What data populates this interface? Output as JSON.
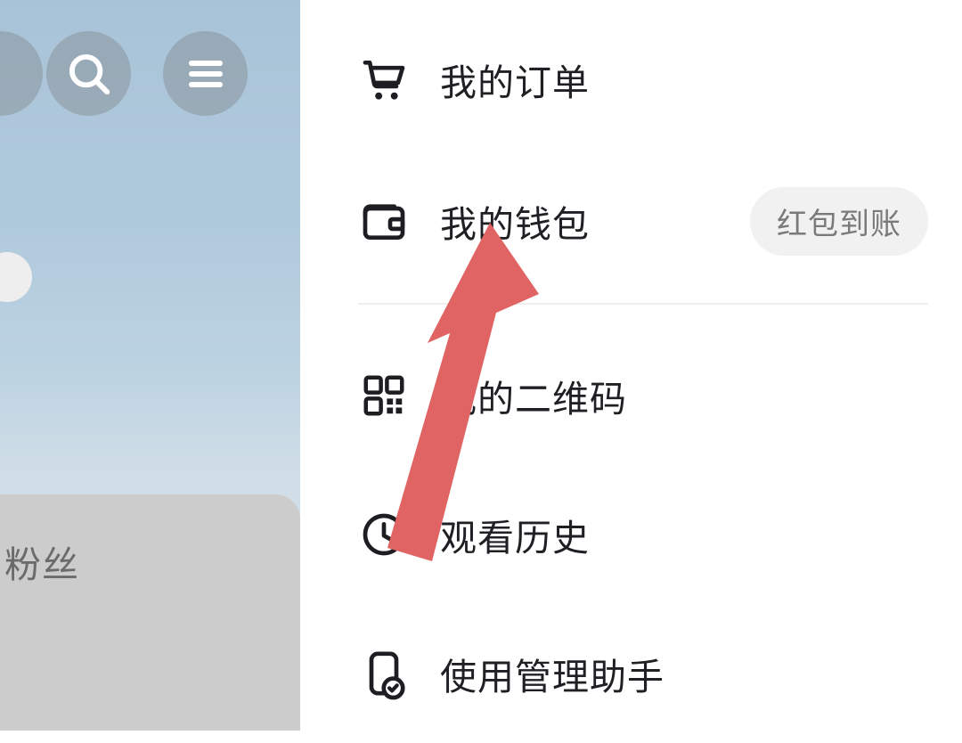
{
  "left": {
    "fans_label": "粉丝"
  },
  "menu": {
    "orders": {
      "label": "我的订单"
    },
    "wallet": {
      "label": "我的钱包",
      "badge": "红包到账"
    },
    "qrcode": {
      "label": "我的二维码"
    },
    "history": {
      "label": "观看历史"
    },
    "assistant": {
      "label": "使用管理助手"
    }
  },
  "annotation": {
    "arrow_color": "#e06463"
  }
}
